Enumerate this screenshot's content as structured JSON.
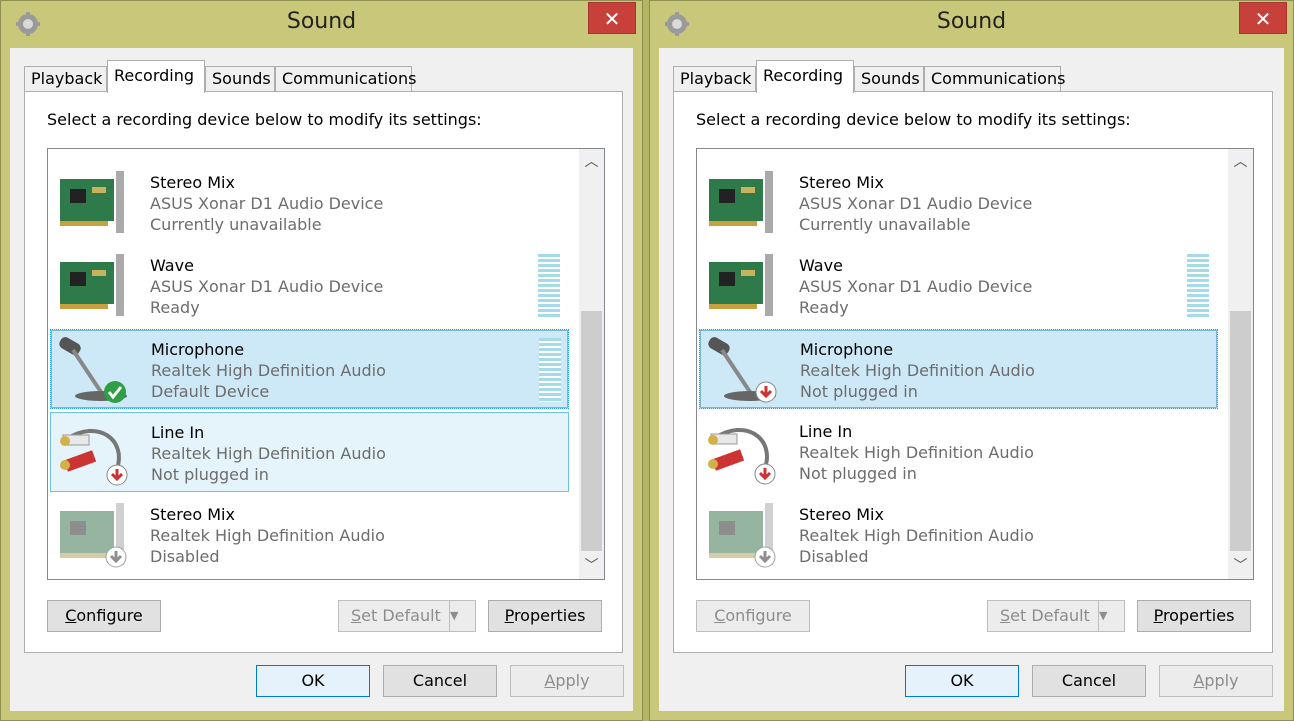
{
  "windows": [
    {
      "title": "Sound",
      "close_glyph": "✕",
      "tabs": [
        "Playback",
        "Recording",
        "Sounds",
        "Communications"
      ],
      "active_tab": "Recording",
      "instruction": "Select a recording device below to modify its settings:",
      "devices": [
        {
          "name": "Stereo Mix",
          "driver": "ASUS Xonar D1 Audio Device",
          "status": "Currently unavailable",
          "icon": "sound-card-icon"
        },
        {
          "name": "Wave",
          "driver": "ASUS Xonar D1 Audio Device",
          "status": "Ready",
          "icon": "sound-card-icon"
        },
        {
          "name": "Microphone",
          "driver": "Realtek High Definition Audio",
          "status": "Default Device",
          "icon": "microphone-icon"
        },
        {
          "name": "Line In",
          "driver": "Realtek High Definition Audio",
          "status": "Not plugged in",
          "icon": "rca-cable-icon"
        },
        {
          "name": "Stereo Mix",
          "driver": "Realtek High Definition Audio",
          "status": "Disabled",
          "icon": "sound-card-icon"
        }
      ],
      "buttons": {
        "configure": {
          "accel": "C",
          "rest": "onfigure"
        },
        "set_default": {
          "accel": "S",
          "rest": "et Default"
        },
        "properties": {
          "accel": "P",
          "rest": "roperties"
        },
        "ok": "OK",
        "cancel": "Cancel",
        "apply": {
          "accel": "A",
          "rest": "pply"
        }
      }
    },
    {
      "title": "Sound",
      "close_glyph": "✕",
      "tabs": [
        "Playback",
        "Recording",
        "Sounds",
        "Communications"
      ],
      "active_tab": "Recording",
      "instruction": "Select a recording device below to modify its settings:",
      "devices": [
        {
          "name": "Stereo Mix",
          "driver": "ASUS Xonar D1 Audio Device",
          "status": "Currently unavailable",
          "icon": "sound-card-icon"
        },
        {
          "name": "Wave",
          "driver": "ASUS Xonar D1 Audio Device",
          "status": "Ready",
          "icon": "sound-card-icon"
        },
        {
          "name": "Microphone",
          "driver": "Realtek High Definition Audio",
          "status": "Not plugged in",
          "icon": "microphone-icon"
        },
        {
          "name": "Line In",
          "driver": "Realtek High Definition Audio",
          "status": "Not plugged in",
          "icon": "rca-cable-icon"
        },
        {
          "name": "Stereo Mix",
          "driver": "Realtek High Definition Audio",
          "status": "Disabled",
          "icon": "sound-card-icon"
        }
      ],
      "buttons": {
        "configure": {
          "accel": "C",
          "rest": "onfigure"
        },
        "set_default": {
          "accel": "S",
          "rest": "et Default"
        },
        "properties": {
          "accel": "P",
          "rest": "roperties"
        },
        "ok": "OK",
        "cancel": "Cancel",
        "apply": {
          "accel": "A",
          "rest": "pply"
        }
      }
    }
  ],
  "colors": {
    "desktop": "#b3b565",
    "frame": "#c9c87a",
    "close": "#c7403a",
    "selected_row": "#cde8f7",
    "hover_row": "#e5f3fb",
    "meter": "#a5dbe9"
  }
}
